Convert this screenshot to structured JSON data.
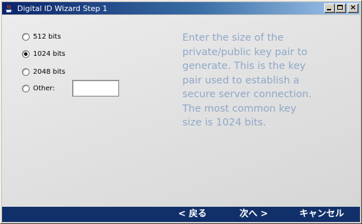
{
  "window": {
    "title": "Digital ID Wizard Step 1",
    "controls": {
      "minimize": "minimize-icon",
      "maximize": "maximize-icon",
      "close": "close-icon"
    }
  },
  "key_size": {
    "options": [
      {
        "label": "512 bits",
        "checked": false
      },
      {
        "label": "1024 bits",
        "checked": true
      },
      {
        "label": "2048 bits",
        "checked": false
      },
      {
        "label": "Other:",
        "checked": false
      }
    ],
    "other_value": ""
  },
  "description": "Enter the size of the\nprivate/public key pair to\ngenerate. This is the key\npair used to establish a\nsecure server connection.\nThe most common key\nsize is 1024 bits.",
  "navigation": {
    "back_label": "< 戻る",
    "next_label": "次へ >",
    "cancel_label": "キャンセル"
  },
  "colors": {
    "titlebar_start": "#0a246a",
    "titlebar_end": "#a6caf0",
    "description_text": "#8fa8c8",
    "bottom_bar": "#11306a"
  }
}
